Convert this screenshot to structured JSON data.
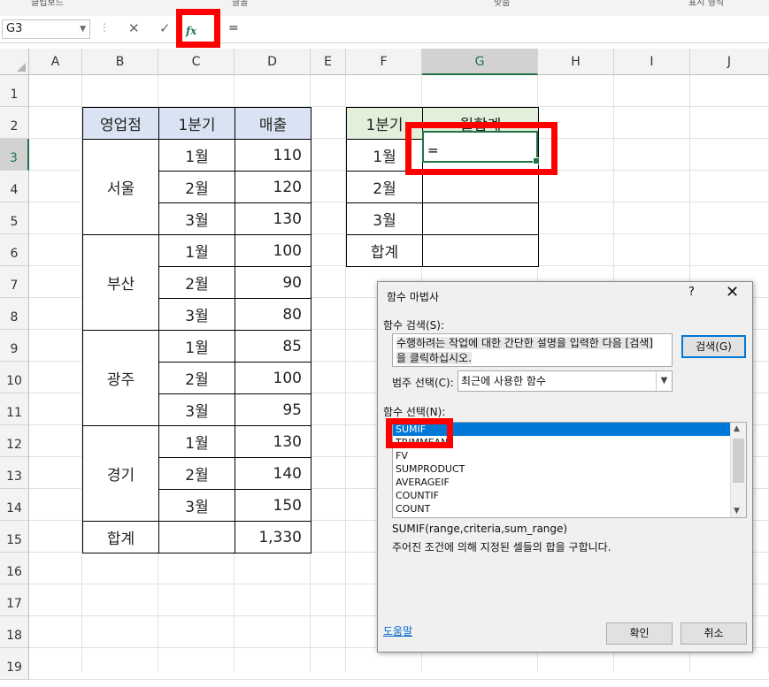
{
  "ribbon": {
    "labels": [
      "클립보드",
      "글꼴",
      "맞춤",
      "표시 형식"
    ]
  },
  "formula_bar": {
    "name_box": "G3",
    "cancel_icon": "✕",
    "enter_icon": "✓",
    "fx_label": "fx",
    "formula": "="
  },
  "columns": [
    "A",
    "B",
    "C",
    "D",
    "E",
    "F",
    "G",
    "H",
    "I",
    "J"
  ],
  "rows": [
    "1",
    "2",
    "3",
    "4",
    "5",
    "6",
    "7",
    "8",
    "9",
    "10",
    "11",
    "12",
    "13",
    "14",
    "15",
    "16",
    "17",
    "18",
    "19"
  ],
  "table1": {
    "headers": [
      "영업점",
      "1분기",
      "매출"
    ],
    "groups": [
      {
        "region": "서울",
        "months": [
          "1월",
          "2월",
          "3월"
        ],
        "sales": [
          "110",
          "120",
          "130"
        ]
      },
      {
        "region": "부산",
        "months": [
          "1월",
          "2월",
          "3월"
        ],
        "sales": [
          "100",
          "90",
          "80"
        ]
      },
      {
        "region": "광주",
        "months": [
          "1월",
          "2월",
          "3월"
        ],
        "sales": [
          "85",
          "100",
          "95"
        ]
      },
      {
        "region": "경기",
        "months": [
          "1월",
          "2월",
          "3월"
        ],
        "sales": [
          "130",
          "140",
          "150"
        ]
      }
    ],
    "total_label": "합계",
    "total_value": "1,330"
  },
  "table2": {
    "headers": [
      "1분기",
      "월합계"
    ],
    "rows": [
      "1월",
      "2월",
      "3월",
      "합계"
    ],
    "active_input": "="
  },
  "dialog": {
    "title": "함수 마법사",
    "help_q": "?",
    "close": "✕",
    "search_label": "함수 검색(S):",
    "search_line1": "수행하려는 작업에 대한 간단한 설명을 입력한 다음 [검색]",
    "search_line2": "을 클릭하십시오.",
    "search_button": "검색(G)",
    "category_label": "범주 선택(C):",
    "category_value": "최근에 사용한 함수",
    "select_label": "함수 선택(N):",
    "functions": [
      "SUMIF",
      "TRIMMEAN",
      "FV",
      "SUMPRODUCT",
      "AVERAGEIF",
      "COUNTIF",
      "COUNT"
    ],
    "selected_index": 0,
    "signature": "SUMIF(range,criteria,sum_range)",
    "description": "주어진 조건에 의해 지정된 셀들의 합을 구합니다.",
    "help_link": "도움말",
    "ok": "확인",
    "cancel": "취소"
  }
}
